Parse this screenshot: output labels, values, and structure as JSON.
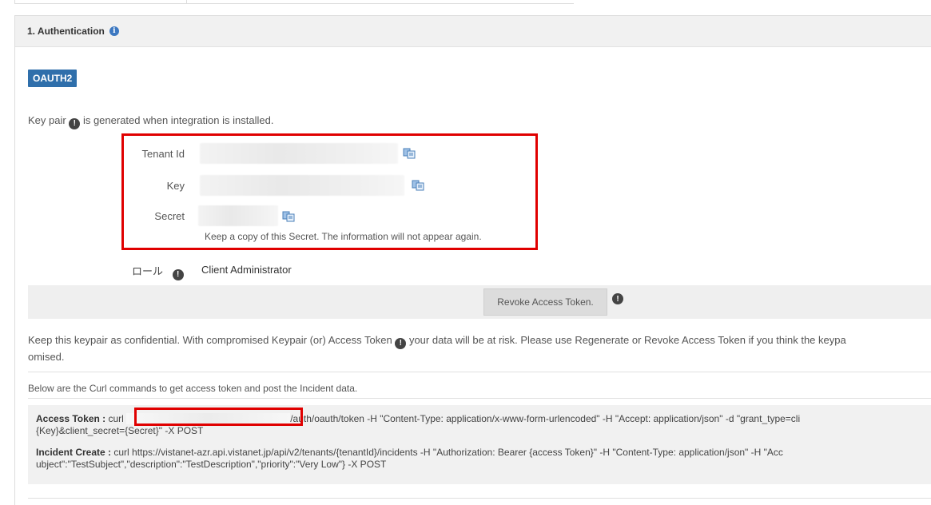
{
  "section": {
    "header_title": "1. Authentication",
    "header_info_icon": "info-circle-icon"
  },
  "auth_type_badge": "OAUTH2",
  "intro": {
    "prefix": "Key pair",
    "suffix": "is generated when integration is installed."
  },
  "credentials": {
    "tenant_label": "Tenant Id",
    "key_label": "Key",
    "secret_label": "Secret",
    "secret_note": "Keep a copy of this Secret. The information will not appear again.",
    "copy_icon": "copy-clipboard-icon"
  },
  "role": {
    "label": "ロール",
    "value": "Client Administrator"
  },
  "revoke": {
    "button_label": "Revoke Access Token."
  },
  "warning": {
    "line1_prefix": "Keep this keypair as confidential. With compromised Keypair (or) Access Token",
    "line1_suffix": "your data will be at risk. Please use Regenerate or Revoke Access Token if you think the keypa",
    "line2": "omised."
  },
  "curl": {
    "intro": "Below are the Curl commands to get access token and post the Incident data.",
    "access_token_label": "Access Token :",
    "access_token_prefix": "curl",
    "access_token_rest": "/auth/oauth/token -H \"Content-Type: application/x-www-form-urlencoded\" -H \"Accept: application/json\" -d \"grant_type=cli",
    "access_token_line2": "{Key}&client_secret={Secret}\" -X POST",
    "incident_label": "Incident Create :",
    "incident_line1": "curl https://vistanet-azr.api.vistanet.jp/api/v2/tenants/{tenantId}/incidents -H \"Authorization: Bearer {access Token}\" -H \"Content-Type: application/json\" -H \"Acc",
    "incident_line2": "ubject\":\"TestSubject\",\"description\":\"TestDescription\",\"priority\":\"Very Low\"} -X POST"
  },
  "colors": {
    "badge": "#2f6fab",
    "highlight": "#e00000",
    "info": "#3c78c1"
  }
}
